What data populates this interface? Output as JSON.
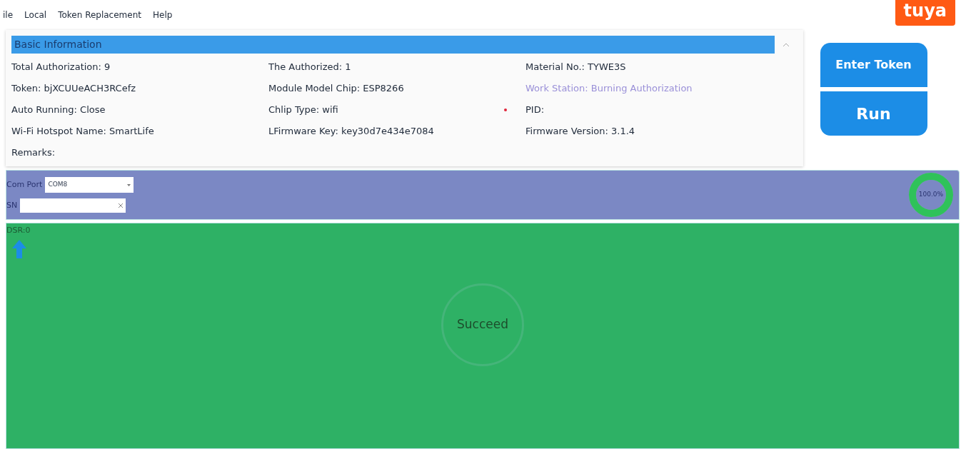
{
  "menu": [
    "ile",
    "Local",
    "Token Replacement",
    "Help"
  ],
  "logo": {
    "text": "tuya"
  },
  "basic_information": {
    "title": "Basic Information",
    "expanded": true,
    "fields": [
      {
        "text": "Total Authorization: 9",
        "highlight": false,
        "required": false
      },
      {
        "text": "The Authorized: 1",
        "highlight": false,
        "required": false
      },
      {
        "text": "Material No.: TYWE3S",
        "highlight": false,
        "required": false
      },
      {
        "text": "Token: bjXCUUeACH3RCefz",
        "highlight": false,
        "required": false
      },
      {
        "text": "Module Model Chip: ESP8266",
        "highlight": false,
        "required": false
      },
      {
        "text": "Work Station: Burning Authorization",
        "highlight": true,
        "required": false
      },
      {
        "text": "Auto Running: Close",
        "highlight": false,
        "required": false
      },
      {
        "text": "Chlip Type: wifi",
        "highlight": false,
        "required": false
      },
      {
        "text": "PID:",
        "highlight": false,
        "required": true
      },
      {
        "text": "Wi-Fi Hotspot Name: SmartLife",
        "highlight": false,
        "required": false
      },
      {
        "text": "LFirmware Key: key30d7e434e7084",
        "highlight": false,
        "required": false
      },
      {
        "text": "Firmware Version: 3.1.4",
        "highlight": false,
        "required": false
      },
      {
        "text": "Remarks:",
        "highlight": false,
        "required": false
      }
    ]
  },
  "buttons": [
    "Enter Token",
    "Run"
  ],
  "port_bar": {
    "com_port_label": "Com Port",
    "com_port_value": "COM8",
    "sn_label": "SN",
    "progress": {
      "level": 1,
      "reading": "100.0%"
    }
  },
  "result": {
    "dsr": "DSR:0",
    "status": "Succeed"
  }
}
